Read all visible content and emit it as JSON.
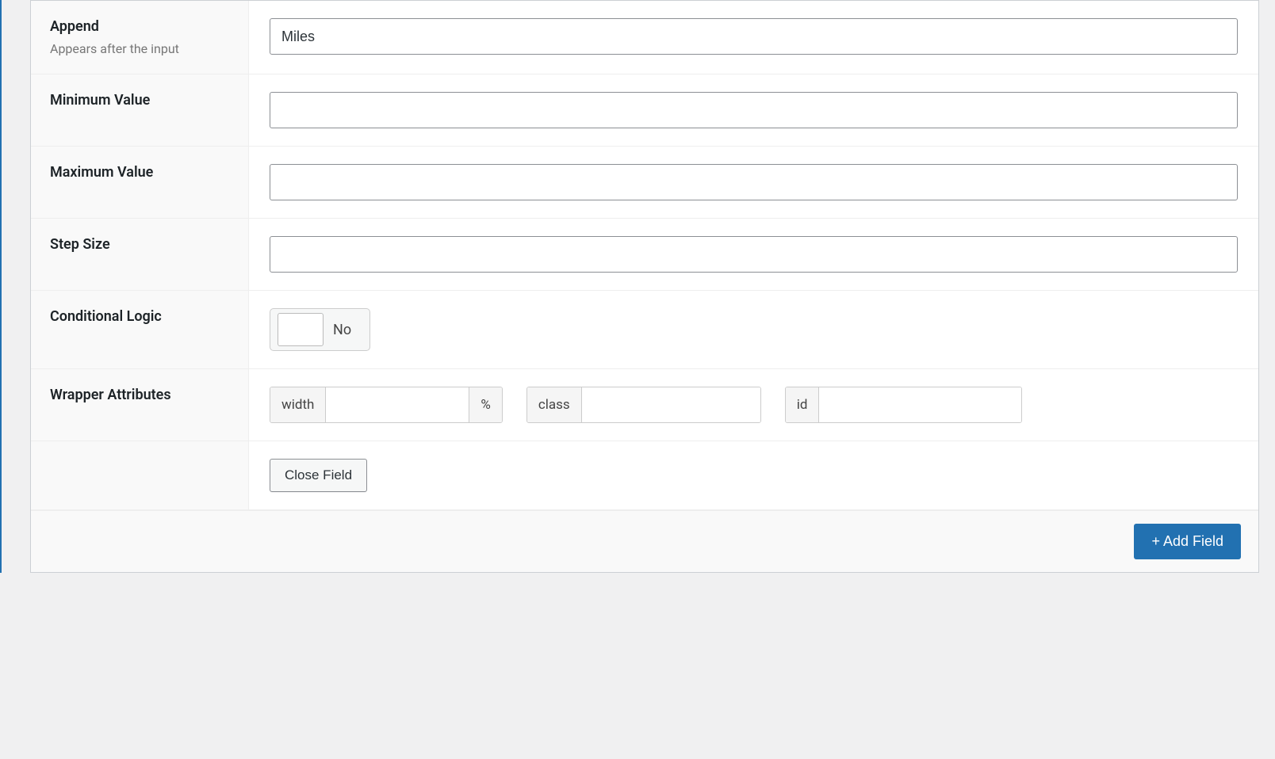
{
  "rows": {
    "append": {
      "title": "Append",
      "desc": "Appears after the input",
      "value": "Miles"
    },
    "min": {
      "title": "Minimum Value",
      "value": ""
    },
    "max": {
      "title": "Maximum Value",
      "value": ""
    },
    "step": {
      "title": "Step Size",
      "value": ""
    },
    "conditional": {
      "title": "Conditional Logic",
      "toggle_label": "No"
    },
    "wrapper": {
      "title": "Wrapper Attributes",
      "width_label": "width",
      "width_suffix": "%",
      "width_value": "",
      "class_label": "class",
      "class_value": "",
      "id_label": "id",
      "id_value": ""
    },
    "close": {
      "button": "Close Field"
    }
  },
  "footer": {
    "add_button": "+ Add Field"
  }
}
